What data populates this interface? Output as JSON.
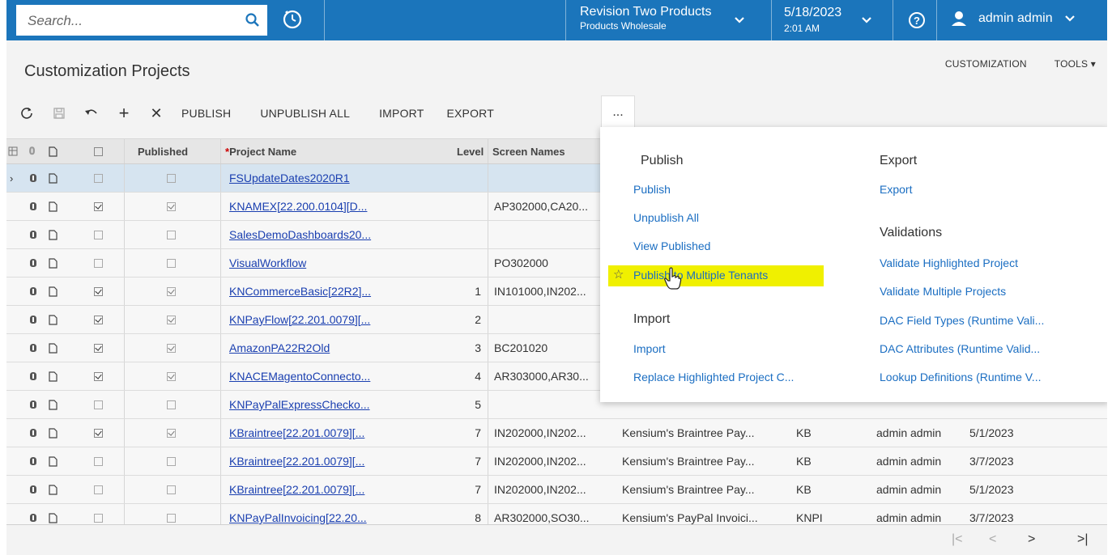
{
  "topbar": {
    "search_placeholder": "Search...",
    "company_name": "Revision Two Products",
    "branch_name": "Products Wholesale",
    "date": "5/18/2023",
    "time": "2:01 AM",
    "user_name": "admin admin",
    "icons": [
      "search-icon",
      "history-icon",
      "chevron-down-icon",
      "help-icon",
      "user-icon"
    ]
  },
  "page": {
    "title": "Customization Projects",
    "menu": [
      "CUSTOMIZATION",
      "TOOLS"
    ]
  },
  "toolbar": {
    "icons": [
      "refresh-icon",
      "save-icon",
      "undo-icon",
      "add-icon",
      "delete-icon"
    ],
    "buttons": [
      "PUBLISH",
      "UNPUBLISH ALL",
      "IMPORT",
      "EXPORT"
    ],
    "more_label": "..."
  },
  "grid": {
    "headers": {
      "published": "Published",
      "project_name": "Project Name",
      "required_mark": "*",
      "level": "Level",
      "screen_names": "Screen Names"
    },
    "rows": [
      {
        "checked": false,
        "published": false,
        "name": "FSUpdateDates2020R1",
        "level": "",
        "screens": "",
        "description": "",
        "code": "",
        "user": "",
        "date": "",
        "selected": true
      },
      {
        "checked": true,
        "published": true,
        "name": "KNAMEX[22.200.0104][D...",
        "level": "",
        "screens": "AP302000,CA20...",
        "description": "",
        "code": "",
        "user": "",
        "date": ""
      },
      {
        "checked": false,
        "published": false,
        "name": "SalesDemoDashboards20...",
        "level": "",
        "screens": "",
        "description": "",
        "code": "",
        "user": "",
        "date": ""
      },
      {
        "checked": false,
        "published": false,
        "name": "VisualWorkflow",
        "level": "",
        "screens": "PO302000",
        "description": "",
        "code": "",
        "user": "",
        "date": ""
      },
      {
        "checked": true,
        "published": true,
        "name": "KNCommerceBasic[22R2]...",
        "level": "1",
        "screens": "IN101000,IN202...",
        "description": "",
        "code": "",
        "user": "",
        "date": ""
      },
      {
        "checked": true,
        "published": true,
        "name": "KNPayFlow[22.201.0079][...",
        "level": "2",
        "screens": "",
        "description": "",
        "code": "",
        "user": "",
        "date": ""
      },
      {
        "checked": true,
        "published": true,
        "name": "AmazonPA22R2Old",
        "level": "3",
        "screens": "BC201020",
        "description": "",
        "code": "",
        "user": "",
        "date": ""
      },
      {
        "checked": true,
        "published": true,
        "name": "KNACEMagentoConnecto...",
        "level": "4",
        "screens": "AR303000,AR30...",
        "description": "",
        "code": "",
        "user": "",
        "date": ""
      },
      {
        "checked": false,
        "published": false,
        "name": "KNPayPalExpressChecko...",
        "level": "5",
        "screens": "",
        "description": "",
        "code": "",
        "user": "",
        "date": ""
      },
      {
        "checked": true,
        "published": true,
        "name": "KBraintree[22.201.0079][...",
        "level": "7",
        "screens": "IN202000,IN202...",
        "description": "Kensium's Braintree Pay...",
        "code": "KB",
        "user": "admin admin",
        "date": "5/1/2023"
      },
      {
        "checked": false,
        "published": false,
        "name": "KBraintree[22.201.0079][...",
        "level": "7",
        "screens": "IN202000,IN202...",
        "description": "Kensium's Braintree Pay...",
        "code": "KB",
        "user": "admin admin",
        "date": "3/7/2023"
      },
      {
        "checked": false,
        "published": false,
        "name": "KBraintree[22.201.0079][...",
        "level": "7",
        "screens": "IN202000,IN202...",
        "description": "Kensium's Braintree Pay...",
        "code": "KB",
        "user": "admin admin",
        "date": "5/1/2023"
      },
      {
        "checked": false,
        "published": false,
        "name": "KNPayPalInvoicing[22.20...",
        "level": "8",
        "screens": "AR302000,SO30...",
        "description": "Kensium's PayPal Invoici...",
        "code": "KNPI",
        "user": "admin admin",
        "date": "3/7/2023"
      }
    ]
  },
  "dropdown": {
    "publish_header": "Publish",
    "publish_items": [
      "Publish",
      "Unpublish All",
      "View Published",
      "Publish to Multiple Tenants"
    ],
    "import_header": "Import",
    "import_items": [
      "Import",
      "Replace Highlighted Project C..."
    ],
    "export_header": "Export",
    "export_items": [
      "Export"
    ],
    "validations_header": "Validations",
    "validations_items": [
      "Validate Highlighted Project",
      "Validate Multiple Projects",
      "DAC Field Types (Runtime Vali...",
      "DAC Attributes (Runtime Valid...",
      "Lookup Definitions (Runtime V..."
    ],
    "highlight_color": "#f0f000",
    "link_color": "#1b6ec2"
  },
  "pager": {
    "first": "|<",
    "prev": "<",
    "next": ">",
    "last": ">|"
  },
  "colors": {
    "topbar": "#1b75bb",
    "link": "#1a3fb0",
    "selected_row": "#d6e4f0"
  }
}
